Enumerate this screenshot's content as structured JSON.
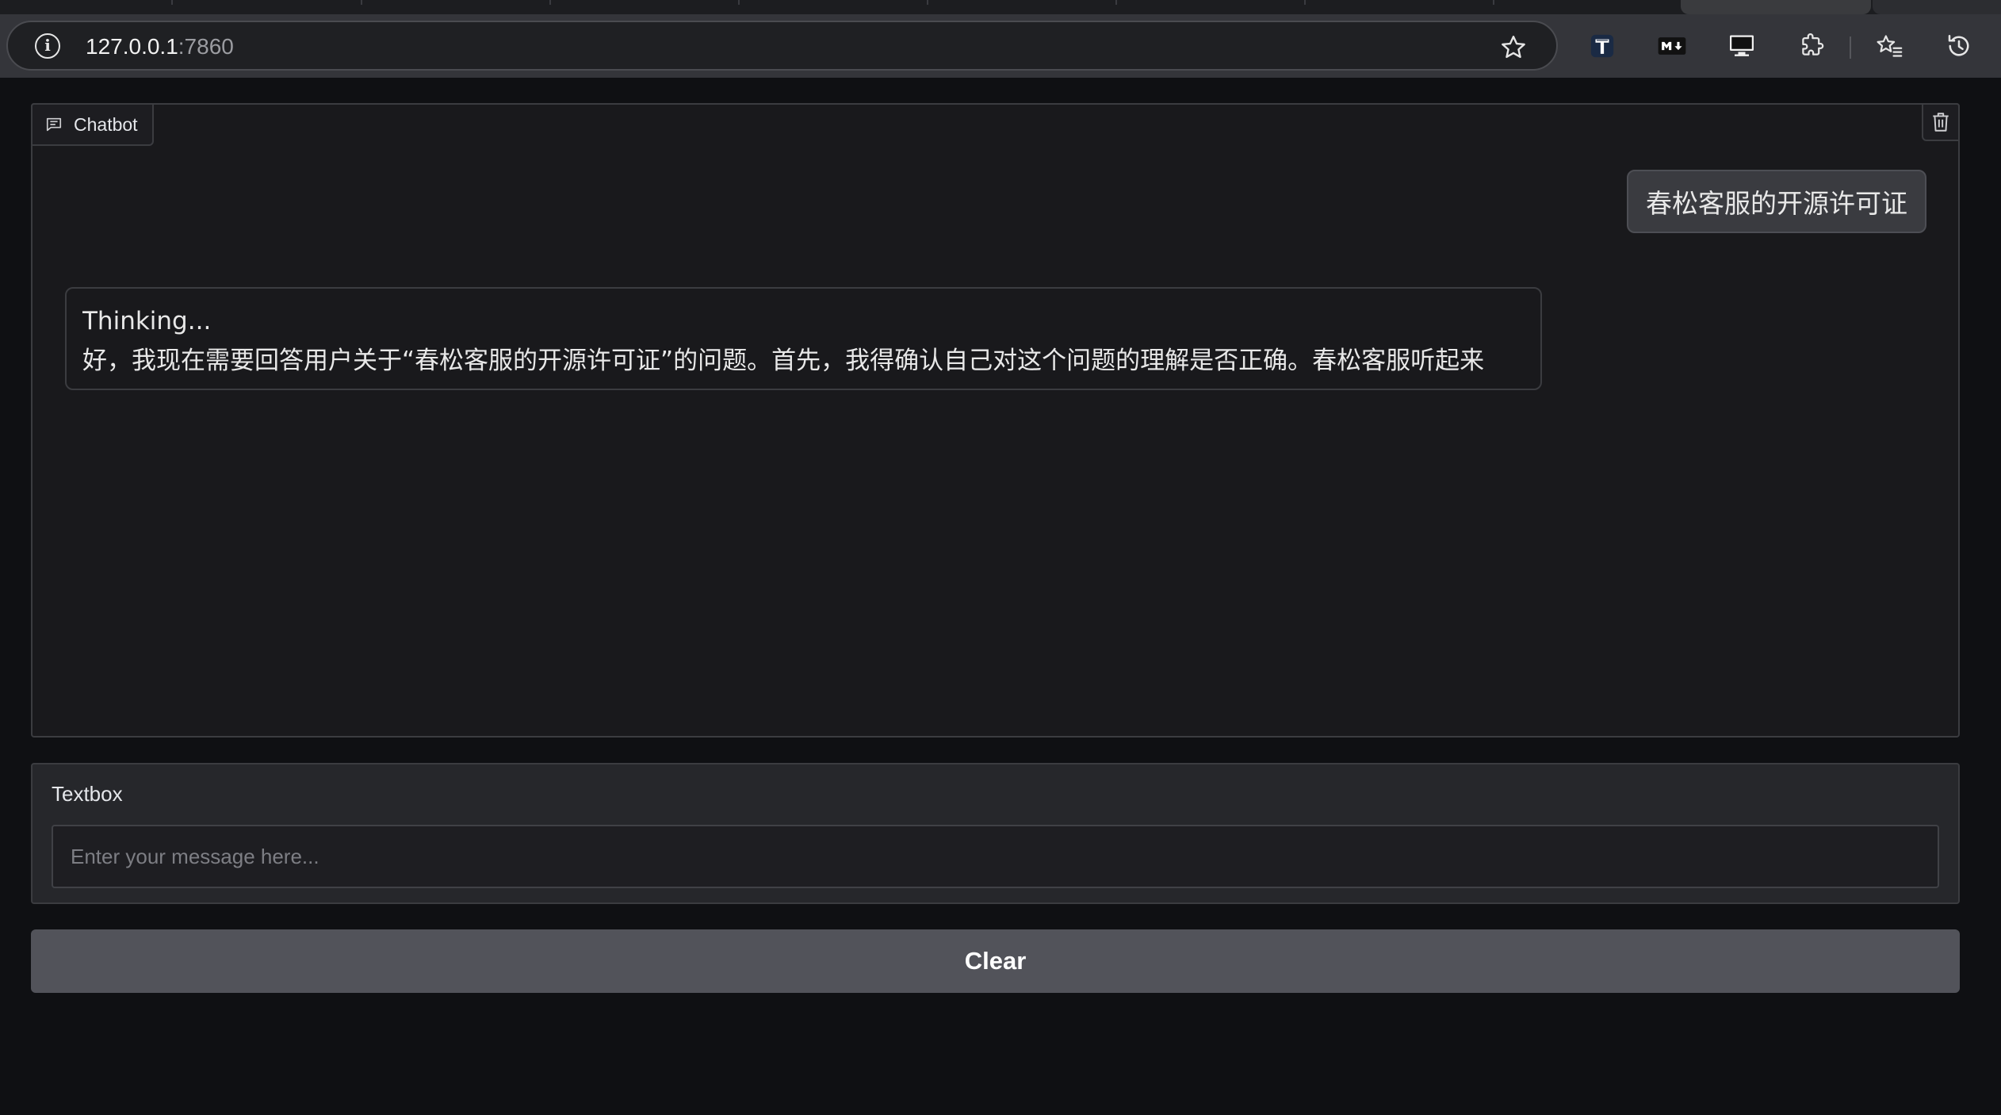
{
  "browser": {
    "url_host": "127.0.0.1",
    "url_port": ":7860"
  },
  "icons": {
    "info": "info-circle-icon",
    "bookmark": "star-outline-icon",
    "ext1": "typora-extension-icon",
    "ext2": "markdown-extension-icon",
    "ext3": "monitor-extension-icon",
    "extensions": "puzzle-piece-icon",
    "favorites": "favorites-star-icon",
    "history": "history-icon",
    "chatbot": "chat-bubble-icon",
    "clear_chat": "trash-icon"
  },
  "chatbot": {
    "label": "Chatbot",
    "messages": {
      "user": "春松客服的开源许可证",
      "bot_line1": "Thinking...",
      "bot_line2": "好，我现在需要回答用户关于“春松客服的开源许可证”的问题。首先，我得确认自己对这个问题的理解是否正确。春松客服听起来"
    }
  },
  "textbox": {
    "label": "Textbox",
    "placeholder": "Enter your message here..."
  },
  "clear_button": {
    "label": "Clear"
  },
  "colors": {
    "page_bg": "#0f1013",
    "panel_bg": "#19191c",
    "button_bg": "#52535a",
    "user_bubble": "#3a3b40"
  }
}
